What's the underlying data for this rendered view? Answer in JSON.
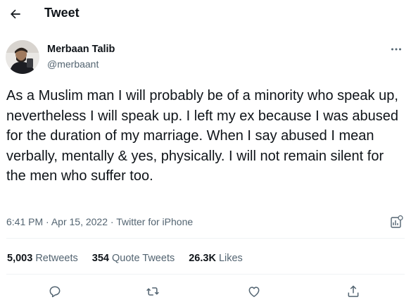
{
  "header": {
    "title": "Tweet",
    "back_icon": "arrow-left-icon"
  },
  "author": {
    "name": "Merbaan Talib",
    "handle": "@merbaant",
    "more_icon": "more-horizontal-icon"
  },
  "tweet": {
    "text": "As a Muslim man I will probably be of a minority who speak up, nevertheless I will speak up. I left my ex because I was abused for the duration of my marriage. When I say abused I mean verbally, mentally & yes, physically. I will not remain silent for the men who suffer too.",
    "time": "6:41 PM",
    "date": "Apr 15, 2022",
    "source": "Twitter for iPhone",
    "separator": "·",
    "analytics_icon": "analytics-icon"
  },
  "stats": {
    "retweets_count": "5,003",
    "retweets_label": "Retweets",
    "quotes_count": "354",
    "quotes_label": "Quote Tweets",
    "likes_count": "26.3K",
    "likes_label": "Likes"
  },
  "actions": [
    "reply-icon",
    "retweet-icon",
    "like-icon",
    "share-icon"
  ],
  "colors": {
    "text": "#0f1419",
    "secondary": "#536471",
    "divider": "#eff3f4"
  }
}
